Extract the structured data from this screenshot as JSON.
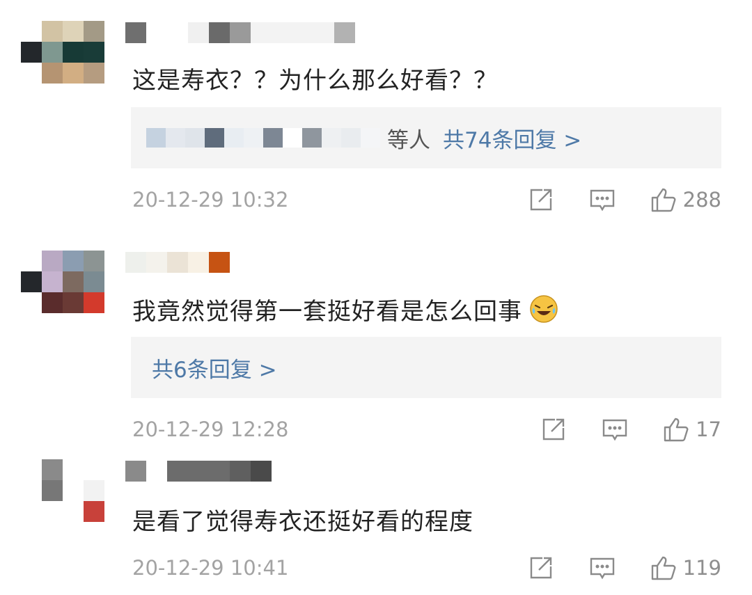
{
  "comments": [
    {
      "text": "这是寿衣？？为什么那么好看？？",
      "reply_summary": {
        "suffix": "等人",
        "link": "共74条回复 >"
      },
      "timestamp": "20-12-29 10:32",
      "likes": "288"
    },
    {
      "text": "我竟然觉得第一套挺好看是怎么回事",
      "emoji": "laughing-crying-emoji",
      "reply_summary": {
        "link": "共6条回复 >"
      },
      "timestamp": "20-12-29 12:28",
      "likes": "17"
    },
    {
      "text": "是看了觉得寿衣还挺好看的程度",
      "timestamp": "20-12-29 10:41",
      "likes": "119"
    }
  ],
  "icons": {
    "share": "share-icon",
    "comment": "comment-icon",
    "like": "thumbs-up-icon"
  },
  "colors": {
    "text": "#222222",
    "link": "#4e79a7",
    "meta": "#a3a3a3",
    "reply_bg": "#f4f4f4"
  }
}
